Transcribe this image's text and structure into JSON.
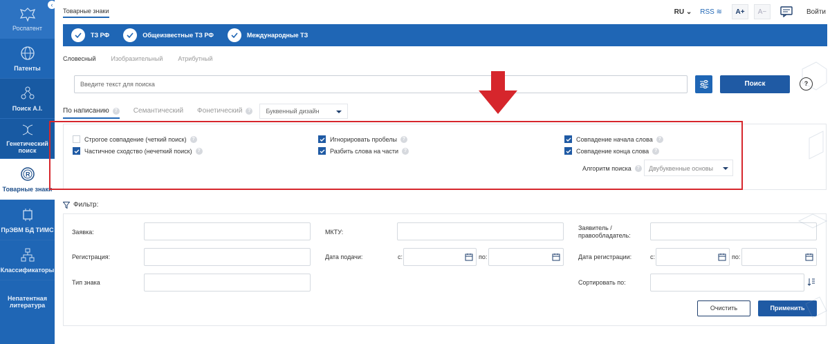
{
  "sidebar": {
    "logo_label": "Роспатент",
    "items": [
      {
        "label": "Патенты",
        "icon": "globe-icon"
      },
      {
        "label": "Поиск А.I.",
        "icon": "network-icon"
      },
      {
        "label": "Генетический поиск",
        "icon": "dna-icon"
      },
      {
        "label": "Товарные знаки",
        "icon": "trademark-icon"
      },
      {
        "label": "ПрЭВМ БД ТИМС",
        "icon": "chip-icon"
      },
      {
        "label": "Классификаторы",
        "icon": "tree-icon"
      },
      {
        "label": "Непатентная литература",
        "icon": "book-icon"
      }
    ]
  },
  "header": {
    "breadcrumb": "Товарные знаки",
    "lang": "RU",
    "rss": "RSS",
    "font_increase": "A+",
    "font_decrease": "A−",
    "login": "Войти"
  },
  "band": {
    "items": [
      {
        "label": "ТЗ РФ",
        "checked": true
      },
      {
        "label": "Общеизвестные ТЗ РФ",
        "checked": true
      },
      {
        "label": "Международные ТЗ",
        "checked": true
      }
    ]
  },
  "type_tabs": [
    {
      "label": "Словесный",
      "active": true
    },
    {
      "label": "Изобразительный",
      "active": false
    },
    {
      "label": "Атрибутный",
      "active": false
    }
  ],
  "search": {
    "placeholder": "Введите текст для поиска",
    "button": "Поиск",
    "help": "?"
  },
  "mode_tabs": [
    {
      "label": "По написанию",
      "active": true
    },
    {
      "label": "Семантический",
      "active": false
    },
    {
      "label": "Фонетический",
      "active": false
    }
  ],
  "mode_dropdown": "Буквенный дизайн",
  "options": {
    "col1": [
      {
        "label": "Строгое совпадение (четкий поиск)",
        "checked": false
      },
      {
        "label": "Частичное сходство (нечеткий поиск)",
        "checked": true
      }
    ],
    "col2": [
      {
        "label": "Игнорировать пробелы",
        "checked": true
      },
      {
        "label": "Разбить слова на части",
        "checked": true
      }
    ],
    "col3": [
      {
        "label": "Совпадение начала слова",
        "checked": true
      },
      {
        "label": "Совпадение конца слова",
        "checked": true
      }
    ],
    "algorithm_label": "Алгоритм поиска",
    "algorithm_value": "Двубуквенные основы"
  },
  "filter": {
    "title": "Фильтр:",
    "zayavka": "Заявка:",
    "mktu": "МКТУ:",
    "zayavitel": "Заявитель / правообладатель:",
    "registration": "Регистрация:",
    "filing_date": "Дата подачи:",
    "reg_date": "Дата регистрации:",
    "from": "с:",
    "to": "по:",
    "mark_type": "Тип знака",
    "sort_by": "Сортировать по:",
    "clear": "Очистить",
    "apply": "Применить"
  },
  "colors": {
    "brand": "#1f66b5",
    "highlight": "#d6262c"
  }
}
